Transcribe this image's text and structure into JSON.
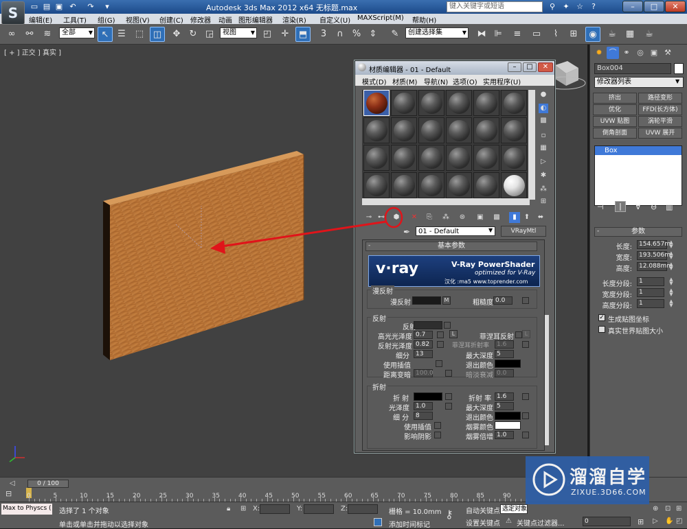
{
  "titlebar": {
    "app_title": "Autodesk 3ds Max  2012 x64  无标题.max",
    "search_placeholder": "键入关键字或短语",
    "logo": "S"
  },
  "menubar": [
    "编辑(E)",
    "工具(T)",
    "组(G)",
    "视图(V)",
    "创建(C)",
    "修改器",
    "动画",
    "图形编辑器",
    "渲染(R)",
    "自定义(U)",
    "MAXScript(M)",
    "帮助(H)"
  ],
  "toolbar": {
    "selection_filter": "全部",
    "ref_coord": "视图",
    "named_selection": "创建选择集"
  },
  "viewport": {
    "label": "[ + ] 正交 ] 真实 ]"
  },
  "material_editor": {
    "title": "材质编辑器 - 01 - Default",
    "menus": [
      "模式(D)",
      "材质(M)",
      "导航(N)",
      "选项(O)",
      "实用程序(U)"
    ],
    "material_name": "01 - Default",
    "material_type": "VRayMtl",
    "rollout_title": "基本参数",
    "vray_banner_logo": "v·ray",
    "vray_banner_title": "V-Ray PowerShader",
    "vray_banner_sub": "optimized for V-Ray",
    "vray_banner_credit": "汉化 :ma5  www.toprender.com",
    "diffuse": {
      "group": "漫反射",
      "diffuse_label": "漫反射",
      "m_label": "M",
      "roughness_label": "粗糙度",
      "roughness": "0.0"
    },
    "reflection": {
      "group": "反射",
      "reflect_label": "反射",
      "hilight_gloss_label": "高光光泽度",
      "hilight_gloss": "0.7",
      "lock_label": "L",
      "fresnel_label": "菲涅耳反射",
      "refl_gloss_label": "反射光泽度",
      "refl_gloss": "0.82",
      "fresnel_ior_label": "菲涅耳折射率",
      "fresnel_ior": "1.6",
      "subdivs_label": "细分",
      "subdivs": "13",
      "max_depth_label": "最大深度",
      "max_depth": "5",
      "use_interp_label": "使用插值",
      "exit_color_label": "退出颜色",
      "dim_dist_label": "距离变暗",
      "dim_dist": "100.0",
      "dim_falloff_label": "暗淡衰减",
      "dim_falloff": "0.0"
    },
    "refraction": {
      "group": "折射",
      "refract_label": "折 射",
      "ior_label": "折射 率",
      "ior": "1.6",
      "gloss_label": "光泽度",
      "gloss": "1.0",
      "max_depth_label": "最大深度",
      "max_depth": "5",
      "subdivs_label": "细 分",
      "subdivs": "8",
      "exit_color_label": "退出颜色",
      "use_interp_label": "使用插值",
      "fog_color_label": "烟雾颜色",
      "affect_shadows_label": "影响阴影",
      "fog_mult_label": "烟雾倍增",
      "fog_mult": "1.0"
    }
  },
  "command_panel": {
    "object_name": "Box004",
    "modifier_list": "修改器列表",
    "modifier_buttons": [
      "挤出",
      "路径变形",
      "优化",
      "FFD(长方体)",
      "UVW 贴图",
      "涡轮平滑",
      "倒角剖面",
      "UVW 展开"
    ],
    "stack_item": "Box",
    "params_title": "参数",
    "params": [
      {
        "label": "长度:",
        "value": "154.657m"
      },
      {
        "label": "宽度:",
        "value": "193.506m"
      },
      {
        "label": "高度:",
        "value": "12.088mm"
      },
      {
        "label": "长度分段:",
        "value": "1"
      },
      {
        "label": "宽度分段:",
        "value": "1"
      },
      {
        "label": "高度分段:",
        "value": "1"
      }
    ],
    "gen_map_coords": "生成贴图坐标",
    "real_world": "真实世界贴图大小"
  },
  "timeline": {
    "frame": "0 / 100",
    "ticks": [
      "0",
      "5",
      "10",
      "15",
      "20",
      "25",
      "30",
      "35",
      "40",
      "45",
      "50",
      "55",
      "60",
      "65",
      "70",
      "75",
      "80",
      "85",
      "90"
    ]
  },
  "status": {
    "script_box": "Max to Physcs (",
    "selected": "选择了 1 个对象",
    "hint": "单击或单击并拖动以选择对象",
    "x_label": "X:",
    "y_label": "Y:",
    "z_label": "Z:",
    "grid": "栅格 = 10.0mm",
    "add_time_tag": "添加时间标记",
    "auto_key": "自动关键点",
    "set_key": "设置关键点",
    "selected_object": "选定对象",
    "key_filters": "关键点过滤器...",
    "frame_field": "0"
  },
  "watermark": {
    "brand": "溜溜自学",
    "url": "ZIXUE.3D66.COM"
  },
  "colors": {
    "annotation_red": "#e0141a",
    "selection_blue": "#3f79d8"
  }
}
